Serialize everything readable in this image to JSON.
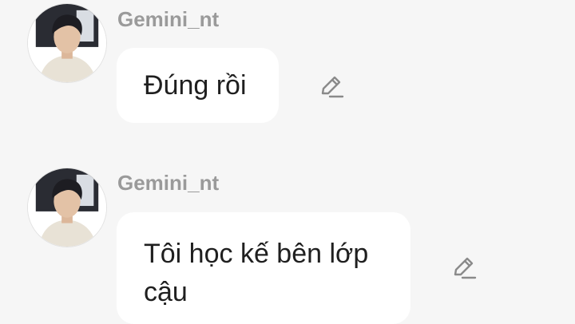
{
  "messages": [
    {
      "sender": "Gemini_nt",
      "text": "Đúng rồi",
      "avatar_icon": "user-avatar-photo",
      "action_icon": "pencil-edit-icon"
    },
    {
      "sender": "Gemini_nt",
      "text": "Tôi học kế bên lớp cậu",
      "avatar_icon": "user-avatar-photo",
      "action_icon": "pencil-edit-icon"
    }
  ],
  "colors": {
    "background": "#f6f6f6",
    "bubble": "#ffffff",
    "sender_name": "#9a9a9a",
    "message_text": "#1f1f1f",
    "icon": "#8a8a8a"
  }
}
